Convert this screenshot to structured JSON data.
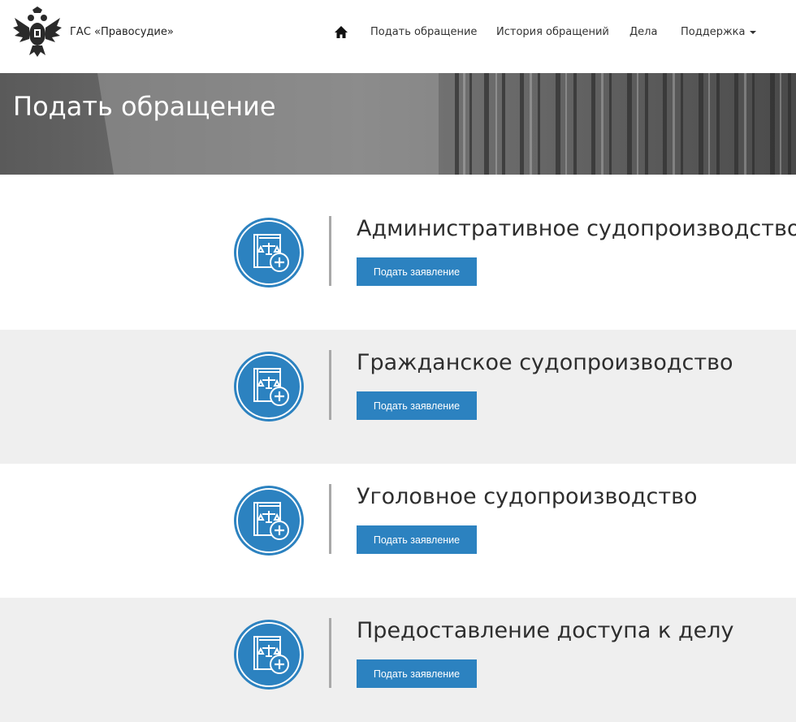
{
  "header": {
    "brand": "ГАС «Правосудие»",
    "nav": {
      "submit": "Подать обращение",
      "history": "История обращений",
      "cases": "Дела",
      "support": "Поддержка"
    }
  },
  "hero": {
    "title": "Подать обращение"
  },
  "sections": [
    {
      "title": "Административное судопроизводство",
      "button": "Подать заявление"
    },
    {
      "title": "Гражданское судопроизводство",
      "button": "Подать заявление"
    },
    {
      "title": "Уголовное судопроизводство",
      "button": "Подать заявление"
    },
    {
      "title": "Предоставление доступа к делу",
      "button": "Подать заявление"
    }
  ],
  "colors": {
    "accent": "#2c82c0",
    "gray_band": "#efefef",
    "hero": "#6a6a6a"
  },
  "icons": {
    "logo": "coat-of-arms-icon",
    "home": "home-icon",
    "section": "law-book-plus-icon"
  }
}
